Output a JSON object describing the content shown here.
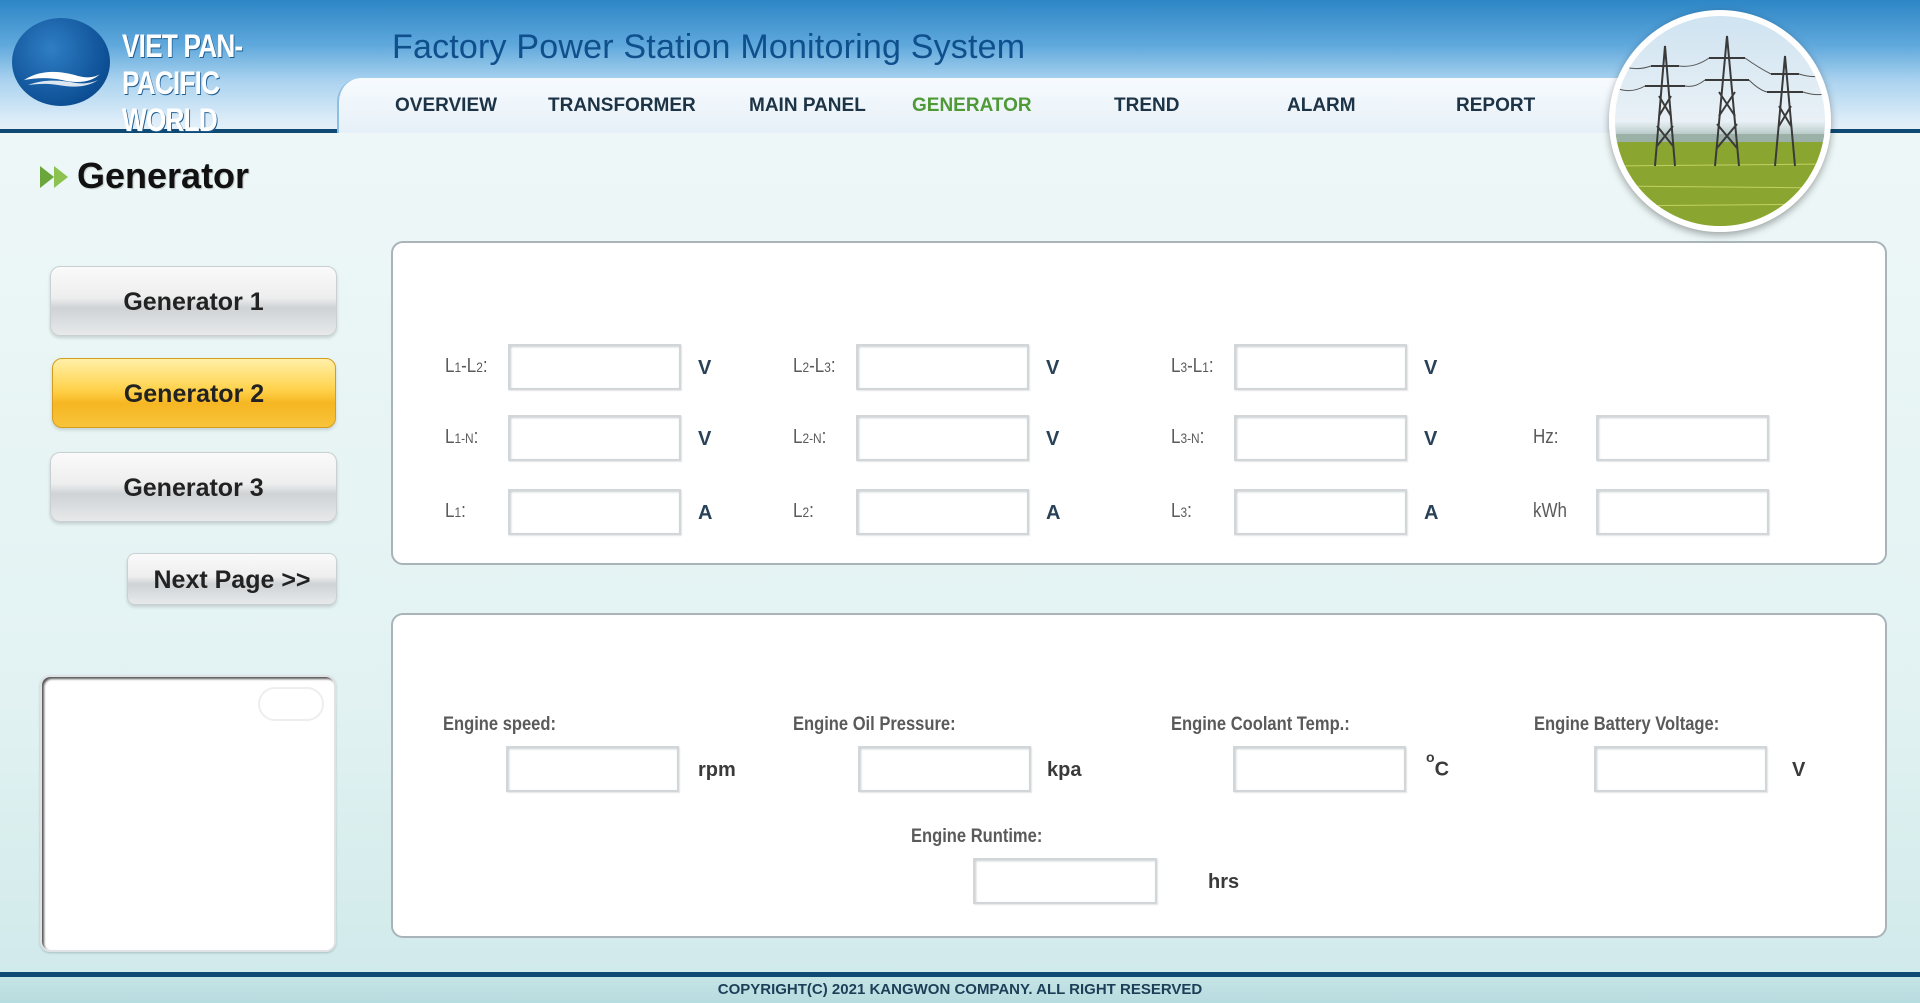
{
  "logo": {
    "line1": "VIET PAN-PACIFIC",
    "line2": "WORLD"
  },
  "app_title": "Factory Power Station Monitoring System",
  "nav": {
    "items": [
      {
        "label": "OVERVIEW"
      },
      {
        "label": "TRANSFORMER"
      },
      {
        "label": "MAIN PANEL"
      },
      {
        "label": "GENERATOR",
        "active": true
      },
      {
        "label": "TREND"
      },
      {
        "label": "ALARM"
      },
      {
        "label": "REPORT"
      }
    ],
    "active_color": "#4f9a37"
  },
  "page_title": "Generator",
  "generators": [
    {
      "label": "Generator 1"
    },
    {
      "label": "Generator 2",
      "active": true
    },
    {
      "label": "Generator 3"
    }
  ],
  "next_page_label": "Next Page >>",
  "electrical": {
    "rows": [
      [
        {
          "label": "L1-L2:",
          "unit": "V",
          "value": ""
        },
        {
          "label": "L2-L3:",
          "unit": "V",
          "value": ""
        },
        {
          "label": "L3-L1:",
          "unit": "V",
          "value": ""
        }
      ],
      [
        {
          "label": "L1-N:",
          "unit": "V",
          "value": ""
        },
        {
          "label": "L2-N:",
          "unit": "V",
          "value": ""
        },
        {
          "label": "L3-N:",
          "unit": "V",
          "value": ""
        },
        {
          "label": "Hz:",
          "unit": "",
          "value": ""
        }
      ],
      [
        {
          "label": "L1:",
          "unit": "A",
          "value": ""
        },
        {
          "label": "L2:",
          "unit": "A",
          "value": ""
        },
        {
          "label": "L3:",
          "unit": "A",
          "value": ""
        },
        {
          "label": "kWh",
          "unit": "",
          "value": ""
        }
      ]
    ]
  },
  "engine": {
    "speed": {
      "label": "Engine speed:",
      "unit": "rpm",
      "value": ""
    },
    "oil_pressure": {
      "label": "Engine Oil Pressure:",
      "unit": "kpa",
      "value": ""
    },
    "coolant_temp": {
      "label": "Engine Coolant Temp.:",
      "unit_sup": "o",
      "unit": "C",
      "value": ""
    },
    "battery_voltage": {
      "label": "Engine Battery Voltage:",
      "unit": "V",
      "value": ""
    },
    "runtime": {
      "label": "Engine Runtime:",
      "unit": "hrs",
      "value": ""
    }
  },
  "footer": "COPYRIGHT(C) 2021 KANGWON COMPANY. ALL RIGHT RESERVED"
}
